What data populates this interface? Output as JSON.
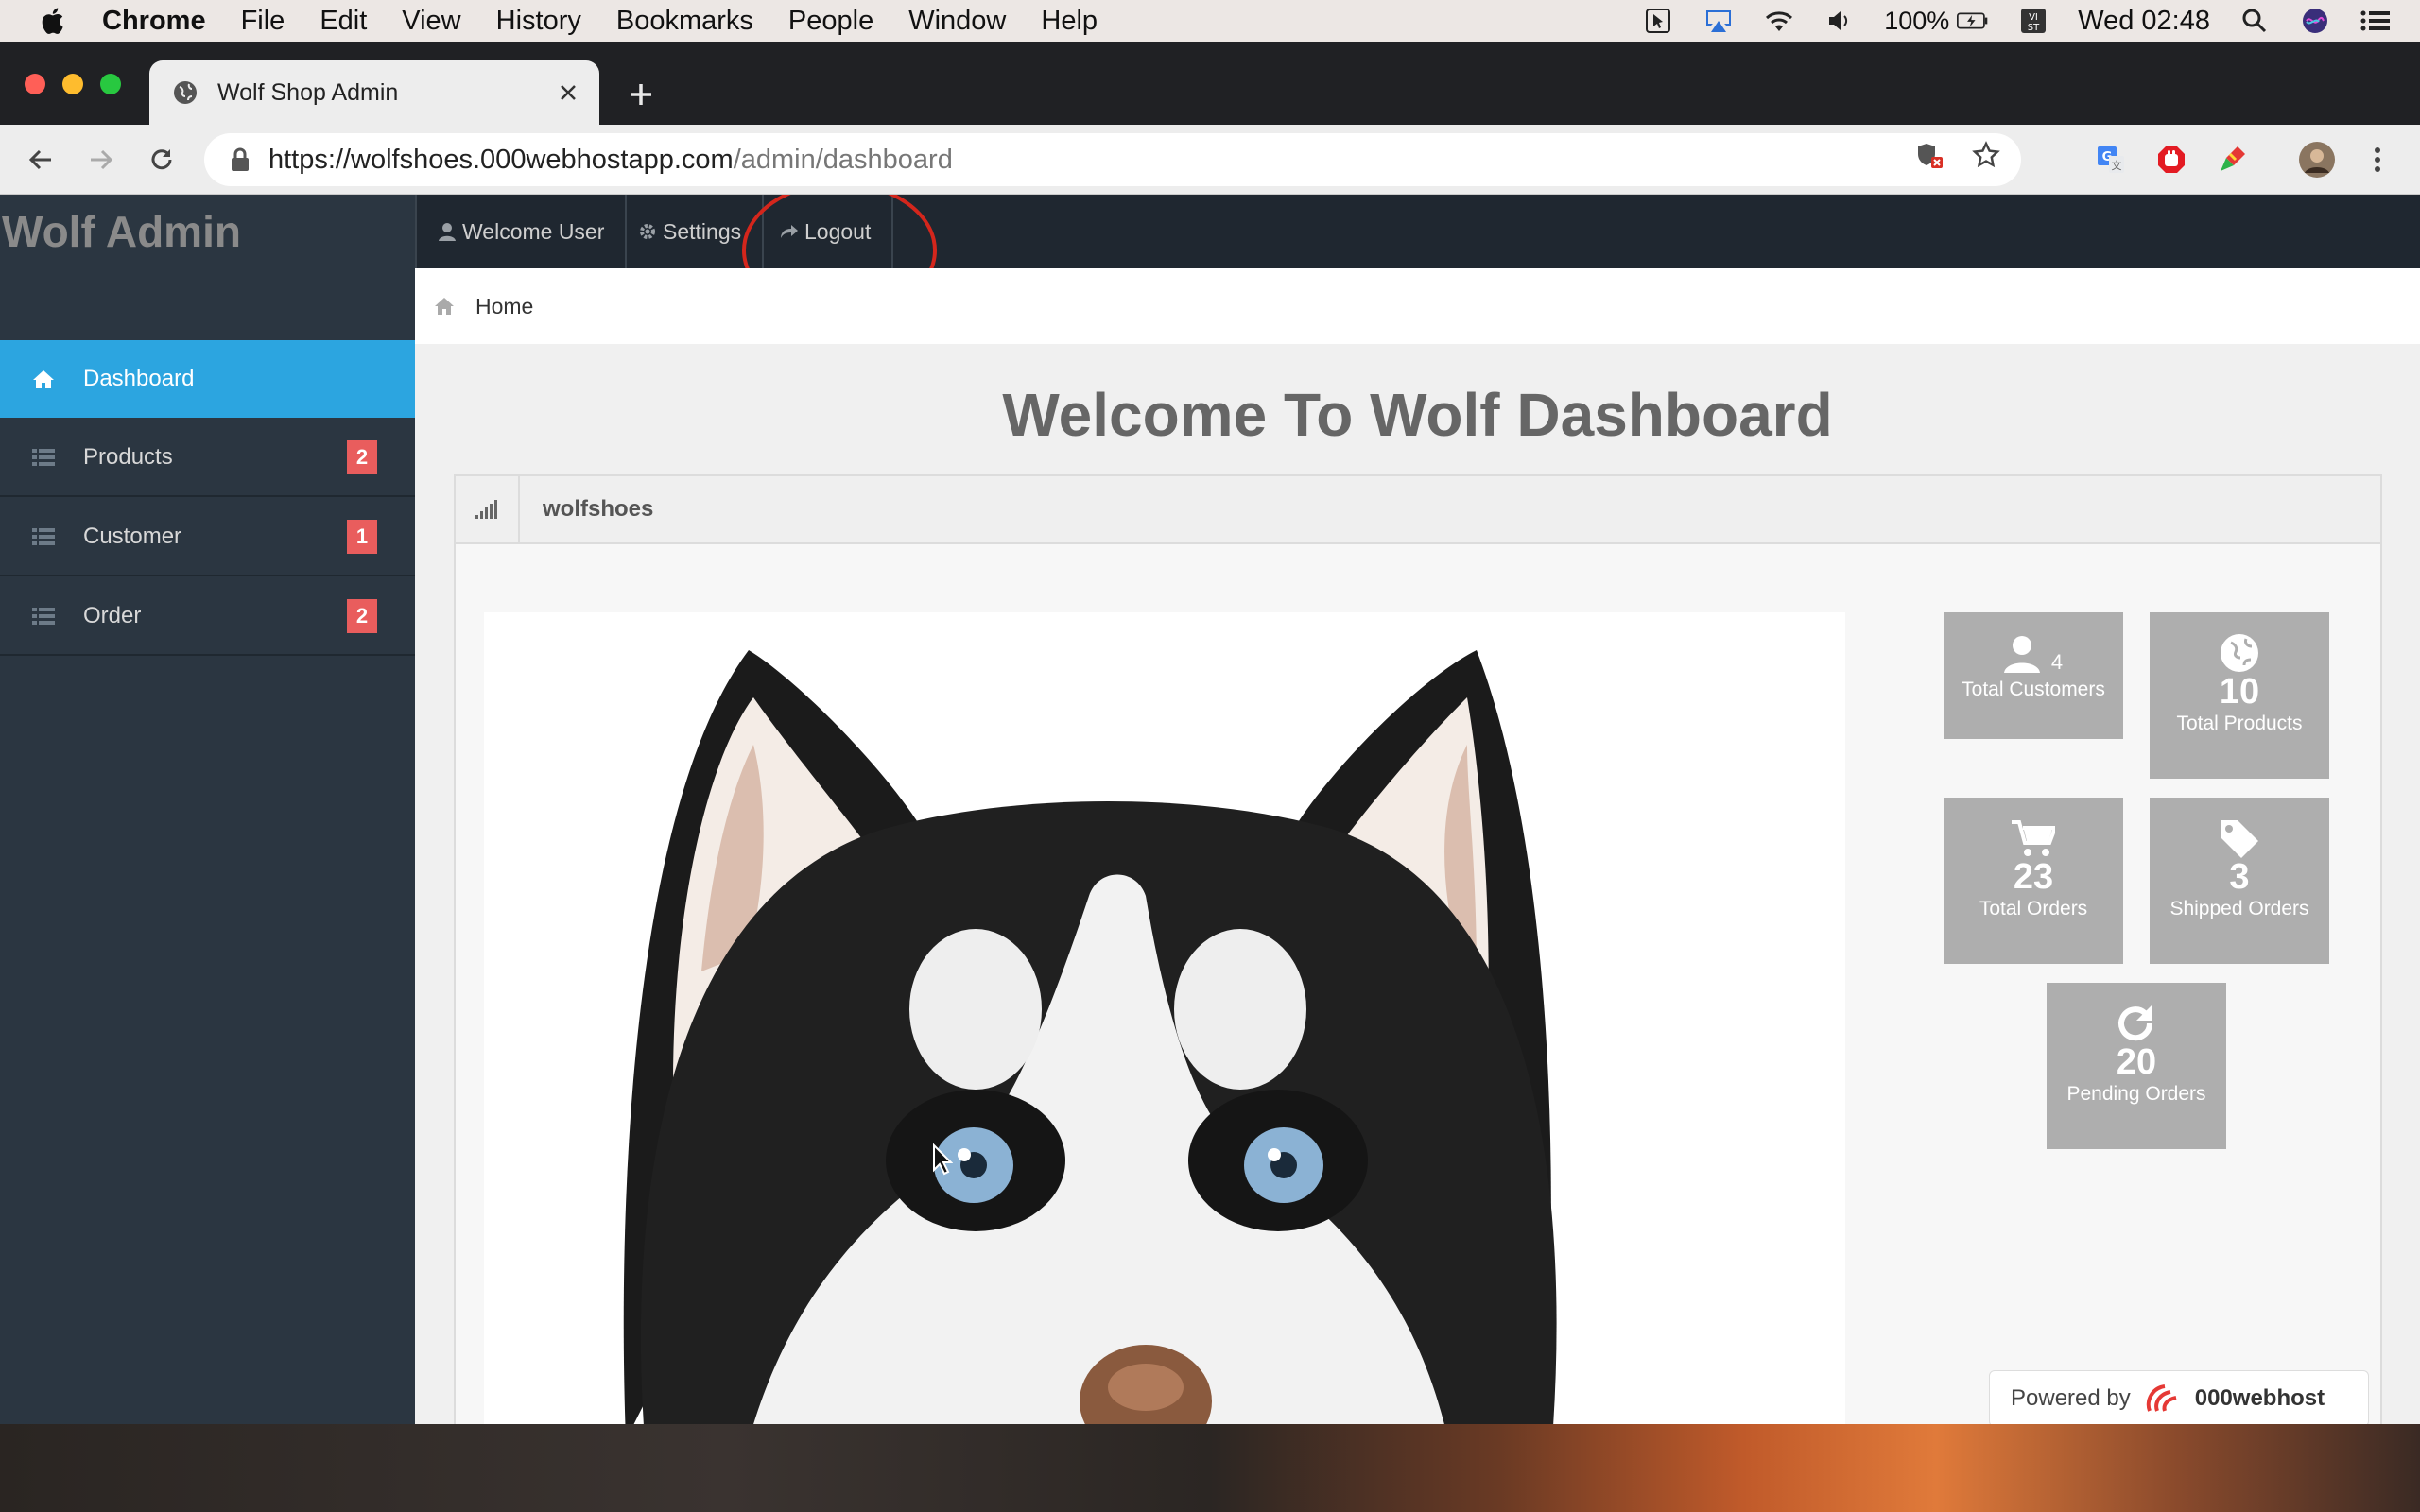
{
  "menubar": {
    "app": "Chrome",
    "items": [
      "File",
      "Edit",
      "View",
      "History",
      "Bookmarks",
      "People",
      "Window",
      "Help"
    ],
    "battery": "100%",
    "clock": "Wed 02:48"
  },
  "browser": {
    "tab_title": "Wolf Shop Admin",
    "url_host": "https://wolfshoes.000webhostapp.com",
    "url_path": "/admin/dashboard"
  },
  "app": {
    "brand": "Wolf Admin",
    "nav": {
      "welcome": "Welcome User",
      "settings": "Settings",
      "logout": "Logout"
    },
    "breadcrumb": "Home",
    "sidebar": [
      {
        "label": "Dashboard",
        "badge": ""
      },
      {
        "label": "Products",
        "badge": "2"
      },
      {
        "label": "Customer",
        "badge": "1"
      },
      {
        "label": "Order",
        "badge": "2"
      }
    ],
    "heading": "Welcome To Wolf Dashboard",
    "panel_title": "wolfshoes",
    "stats": {
      "customers": {
        "value": "4",
        "label": "Total Customers"
      },
      "products": {
        "value": "10",
        "label": "Total Products"
      },
      "orders": {
        "value": "23",
        "label": "Total Orders"
      },
      "shipped": {
        "value": "3",
        "label": "Shipped Orders"
      },
      "pending": {
        "value": "20",
        "label": "Pending Orders"
      }
    },
    "powered_by": "Powered by",
    "powered_host": "000webhost"
  },
  "colors": {
    "sidebar_bg": "#2b3641",
    "active_item": "#2ca5e0",
    "badge": "#e95d5d",
    "stat_tile": "#aeaeae",
    "annotation_circle": "#d4261c"
  }
}
